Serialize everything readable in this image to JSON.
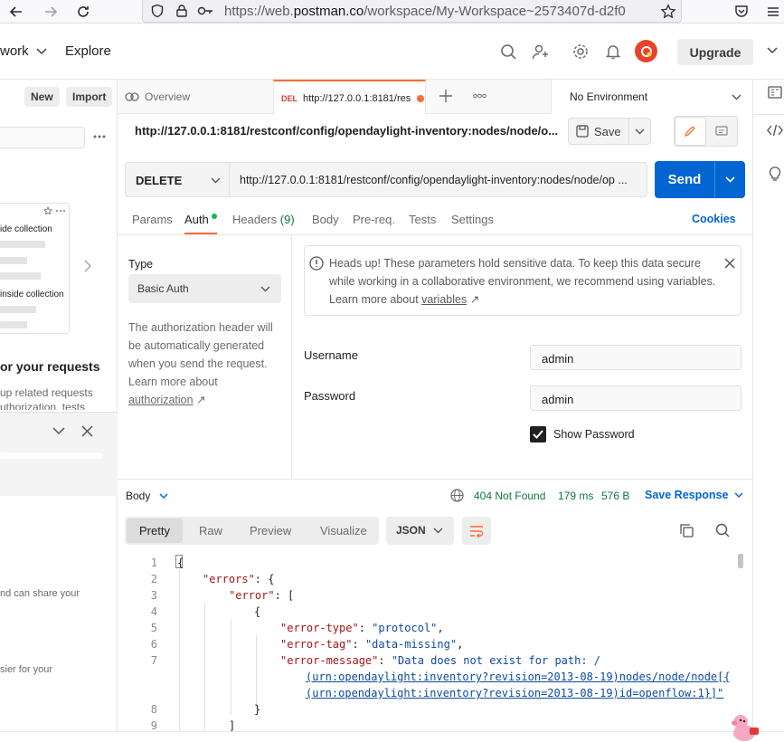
{
  "browser": {
    "url_prefix": "https://web.",
    "url_domain": "postman.co",
    "url_suffix": "/workspace/My-Workspace~2573407d-d2f0"
  },
  "header": {
    "workspaces_label": "work",
    "explore_label": "Explore",
    "upgrade_label": "Upgrade"
  },
  "sidebar": {
    "new_label": "New",
    "import_label": "Import",
    "card_item_1": "ide collection",
    "card_item_2": "inside collection",
    "heading": "or your requests",
    "text_1": "up related requests",
    "text_2": "uthorization, tests",
    "text_3": "nd can share your",
    "text_4": "sier for your"
  },
  "tabs": {
    "overview_label": "Overview",
    "active_method": "DEL",
    "active_url": "http://127.0.0.1:8181/res",
    "environment": "No Environment"
  },
  "request": {
    "title": "http://127.0.0.1:8181/restconf/config/opendaylight-inventory:nodes/node/o...",
    "save_label": "Save",
    "method": "DELETE",
    "url": "http://127.0.0.1:8181/restconf/config/opendaylight-inventory:nodes/node/op ...",
    "send_label": "Send"
  },
  "subtabs": {
    "params": "Params",
    "auth": "Auth",
    "headers": "Headers",
    "headers_count": "(9)",
    "body": "Body",
    "prereq": "Pre-req.",
    "tests": "Tests",
    "settings": "Settings",
    "cookies": "Cookies"
  },
  "auth": {
    "type_label": "Type",
    "type_value": "Basic Auth",
    "description": "The authorization header will be automatically generated when you send the request. Learn more about",
    "description_link": "authorization",
    "notice_text": "Heads up! These parameters hold sensitive data. To keep this data secure while working in a collaborative environment, we recommend using variables. Learn more about",
    "notice_link": "variables",
    "username_label": "Username",
    "username_value": "admin",
    "password_label": "Password",
    "password_value": "admin",
    "show_password_label": "Show Password",
    "show_password_checked": true
  },
  "response": {
    "body_label": "Body",
    "status": "404 Not Found",
    "time": "179 ms",
    "size": "576 B",
    "save_response_label": "Save Response",
    "view_tabs": [
      "Pretty",
      "Raw",
      "Preview",
      "Visualize"
    ],
    "format": "JSON",
    "code_lines": [
      {
        "n": "1",
        "text": "{"
      },
      {
        "n": "2",
        "key": "\"errors\"",
        "rest": ": {"
      },
      {
        "n": "3",
        "key": "\"error\"",
        "rest": ": ["
      },
      {
        "n": "4",
        "text": "{"
      },
      {
        "n": "5",
        "key": "\"error-type\"",
        "rest": ": ",
        "value": "\"protocol\"",
        "tail": ","
      },
      {
        "n": "6",
        "key": "\"error-tag\"",
        "rest": ": ",
        "value": "\"data-missing\"",
        "tail": ","
      },
      {
        "n": "7",
        "key": "\"error-message\"",
        "rest": ": ",
        "value": "\"Data does not exist for path: /"
      },
      {
        "n": "",
        "link": "(urn:opendaylight:inventory?revision=2013-08-19)nodes/node/node[{"
      },
      {
        "n": "",
        "link": "(urn:opendaylight:inventory?revision=2013-08-19)id=openflow:1}]\""
      },
      {
        "n": "8",
        "text": "}"
      },
      {
        "n": "9",
        "text": "]"
      }
    ]
  },
  "colors": {
    "accent": "#ff6c37",
    "send_blue": "#0265d2",
    "status_green": "#0c7a3a",
    "link_blue": "#0265d2"
  }
}
